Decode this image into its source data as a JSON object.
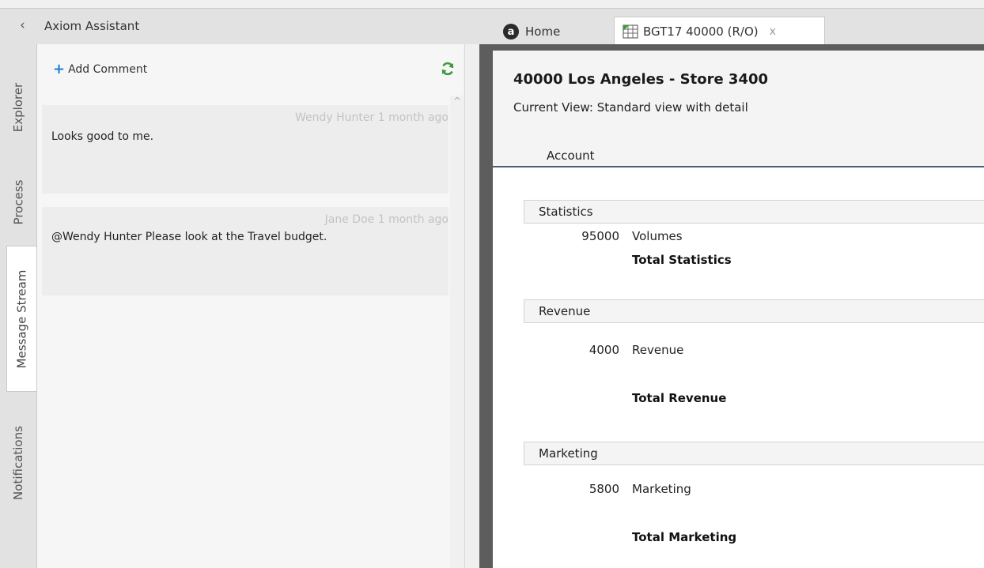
{
  "assistant": {
    "collapse_glyph": "‹",
    "title": "Axiom Assistant",
    "tabs": [
      "Explorer",
      "Process",
      "Message Stream",
      "Notifications"
    ],
    "active_tab": "Message Stream"
  },
  "messages": {
    "add_comment_label": "Add Comment",
    "items": [
      {
        "author_time": "Wendy Hunter  1 month ago",
        "text": "Looks good to me."
      },
      {
        "author_time": "Jane Doe  1 month ago",
        "text": "@Wendy Hunter Please look at the Travel budget."
      }
    ]
  },
  "doc_tabs": {
    "home_label": "Home",
    "home_glyph": "a",
    "active_label": "BGT17 40000 (R/O)",
    "close_glyph": "x"
  },
  "document": {
    "title": "40000 Los Angeles - Store 3400",
    "current_view": "Current View:  Standard view with detail",
    "column_header": "Account",
    "sections": [
      {
        "label": "Statistics",
        "rows": [
          {
            "code": "95000",
            "name": "Volumes"
          }
        ],
        "total": "Total Statistics"
      },
      {
        "label": "Revenue",
        "rows": [
          {
            "code": "4000",
            "name": "Revenue"
          }
        ],
        "total": "Total Revenue"
      },
      {
        "label": "Marketing",
        "rows": [
          {
            "code": "5800",
            "name": "Marketing"
          }
        ],
        "total": "Total Marketing"
      }
    ]
  },
  "colors": {
    "accent_blue": "#1e7fd6",
    "refresh_green": "#3b9a3b",
    "header_rule": "#4a5d7a"
  }
}
